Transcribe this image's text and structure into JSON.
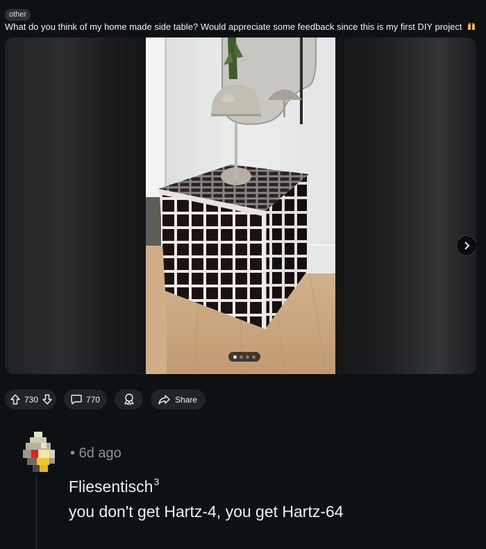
{
  "post": {
    "flair": "other",
    "title": "What do you think of my home made side table? Would appreciate some feedback since this is my first DIY project",
    "title_emoji": "raising-hands-emoji",
    "gallery": {
      "total_images": 4,
      "current_index": 1
    },
    "actions": {
      "upvotes": "730",
      "comments": "770",
      "share_label": "Share"
    }
  },
  "comment": {
    "time": "6d ago",
    "separator": "•",
    "username": "Fliesentisch",
    "username_sup": "3",
    "body": "you don't get Hartz-4, you get Hartz-64"
  },
  "colors": {
    "background": "#0e1113",
    "pill": "#1f2527",
    "text": "#eef1f3",
    "muted": "#8b949a",
    "tile": "#1a1214",
    "grout": "#e6e3df",
    "floor": "#c8a47e"
  }
}
